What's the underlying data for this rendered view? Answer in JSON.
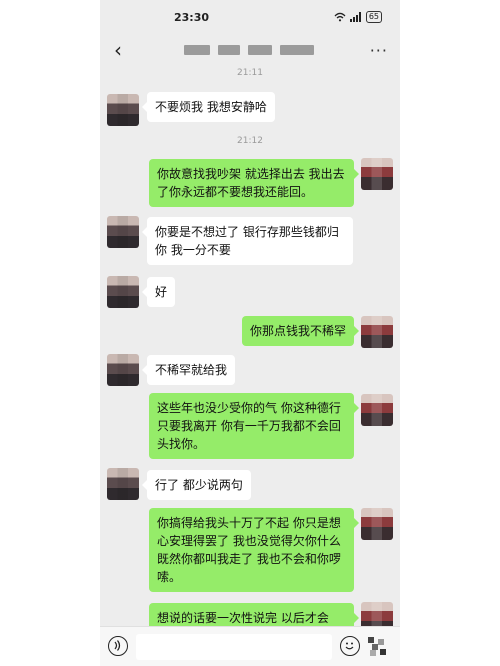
{
  "status_bar": {
    "time": "23:30",
    "battery": "65"
  },
  "navbar": {
    "back_glyph": "‹",
    "more_glyph": "···"
  },
  "timestamps": [
    "21:11",
    "21:12"
  ],
  "messages": [
    {
      "side": "left",
      "text": "不要烦我 我想安静哈"
    },
    {
      "side": "right",
      "text": "你故意找我吵架 就选择出去 我出去了你永远都不要想我还能回。"
    },
    {
      "side": "left",
      "text": "你要是不想过了 银行存那些钱都归你 我一分不要"
    },
    {
      "side": "left",
      "text": "好"
    },
    {
      "side": "right",
      "text": "你那点钱我不稀罕"
    },
    {
      "side": "left",
      "text": "不稀罕就给我"
    },
    {
      "side": "right",
      "text": "这些年也没少受你的气 你这种德行 只要我离开 你有一千万我都不会回头找你。"
    },
    {
      "side": "left",
      "text": "行了 都少说两句"
    },
    {
      "side": "right",
      "text": "你搞得给我头十万了不起 你只是想心安理得罢了 我也没觉得欠你什么 既然你都叫我走了 我也不会和你啰嗦。"
    },
    {
      "side": "right",
      "text": "想说的话要一次性说完 以后才会"
    }
  ],
  "icons": [
    "back-icon",
    "more-icon",
    "wifi-icon",
    "signal-icon",
    "battery-icon",
    "voice-icon",
    "emoji-icon",
    "plus-icon"
  ]
}
